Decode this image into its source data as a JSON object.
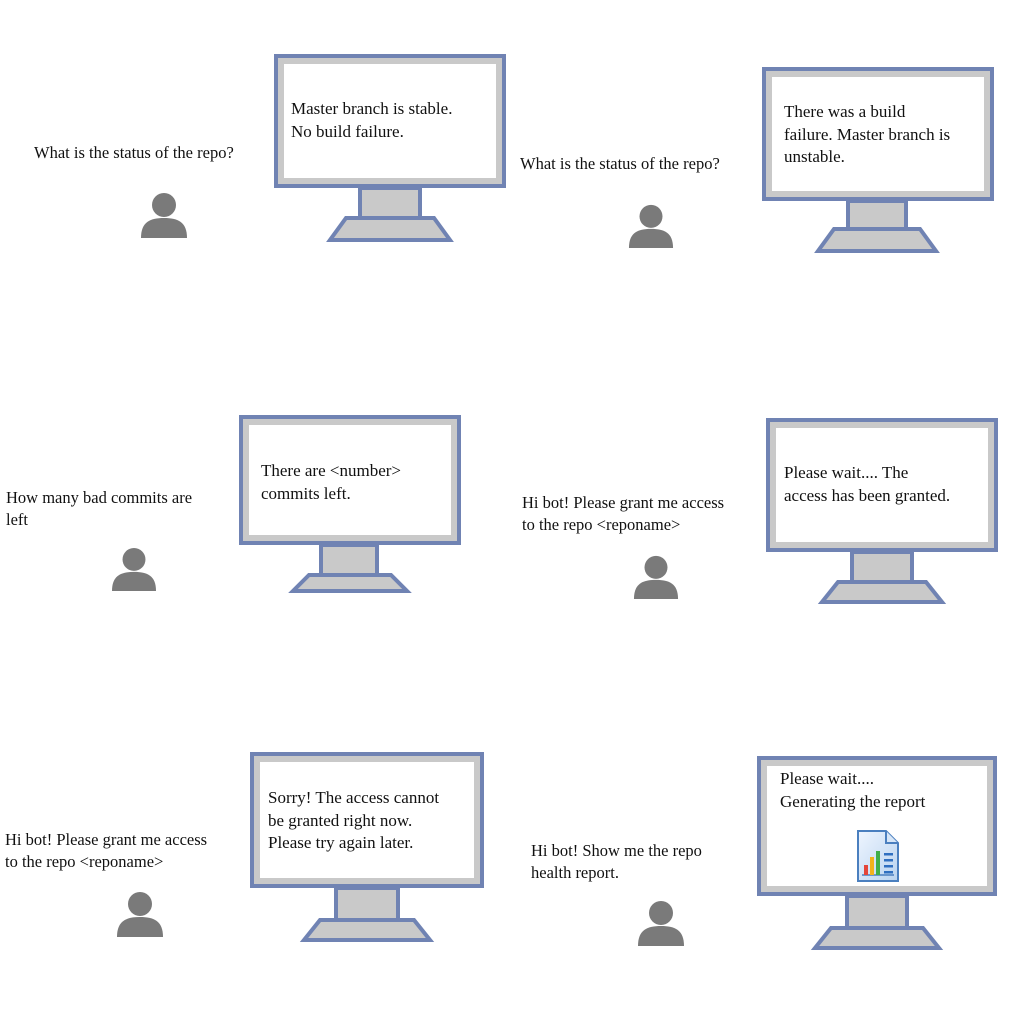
{
  "panels": [
    {
      "question": [
        "What is the status of the repo?"
      ],
      "reply": [
        "Master branch is stable.",
        "No build failure."
      ]
    },
    {
      "question": [
        "What is the status of the repo?"
      ],
      "reply": [
        "There was a build",
        "failure. Master branch is",
        "unstable."
      ]
    },
    {
      "question": [
        "How many bad commits are",
        "left"
      ],
      "reply": [
        "There are <number>",
        "commits left."
      ]
    },
    {
      "question": [
        "Hi bot! Please grant me access",
        "to the repo <reponame>"
      ],
      "reply": [
        "Please wait.... The",
        "access has been granted."
      ]
    },
    {
      "question": [
        "Hi bot! Please grant me access",
        "to the repo <reponame>"
      ],
      "reply": [
        "Sorry! The access cannot",
        "be granted right now.",
        "Please try again later."
      ]
    },
    {
      "question": [
        "Hi bot! Show me the repo",
        "health report."
      ],
      "reply": [
        "Please wait....",
        "Generating the report"
      ],
      "reply_icon": "report-chart-icon"
    }
  ],
  "colors": {
    "monitor_frame": "#7083b3",
    "monitor_bezel": "#c9c9c9",
    "screen": "#ffffff",
    "user_icon": "#7a7a7a"
  }
}
